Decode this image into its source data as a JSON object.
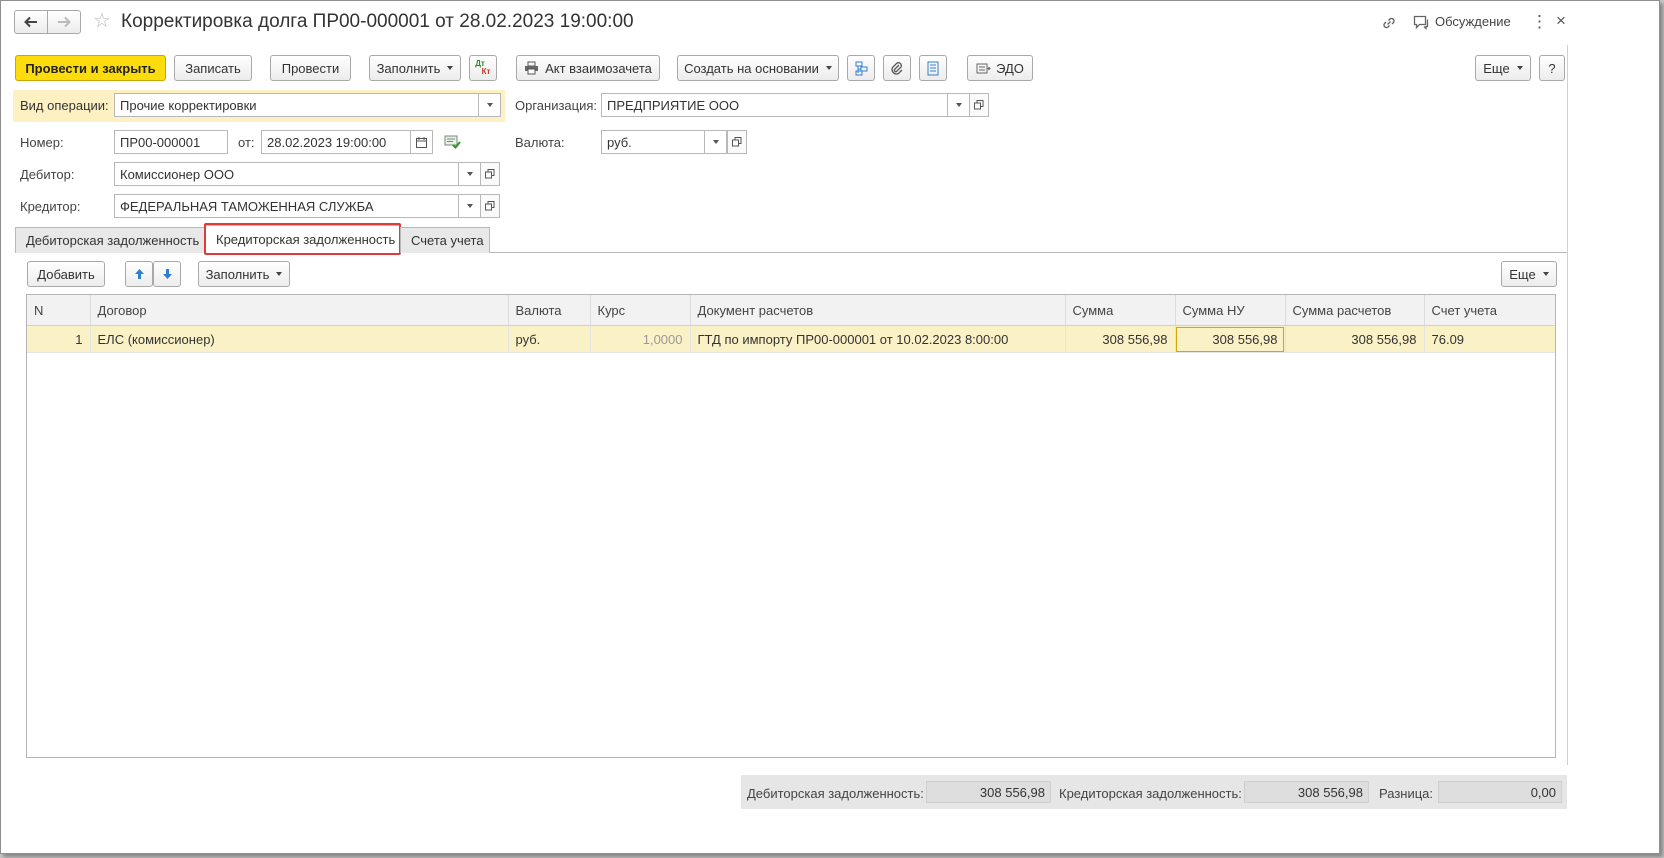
{
  "window": {
    "title": "Корректировка долга ПР00-000001 от 28.02.2023 19:00:00",
    "discussion_label": "Обсуждение"
  },
  "toolbar": {
    "post_close": "Провести и закрыть",
    "save": "Записать",
    "post": "Провести",
    "fill": "Заполнить",
    "dt_kt_top": "Дт",
    "dt_kt_bottom": "Кт",
    "offset_act": "Акт взаимозачета",
    "create_based": "Создать на основании",
    "edo": "ЭДО",
    "more": "Еще",
    "help": "?"
  },
  "form": {
    "operation_label": "Вид операции:",
    "operation_value": "Прочие корректировки",
    "org_label": "Организация:",
    "org_value": "ПРЕДПРИЯТИЕ ООО",
    "number_label": "Номер:",
    "number_value": "ПР00-000001",
    "date_label": "от:",
    "date_value": "28.02.2023 19:00:00",
    "currency_label": "Валюта:",
    "currency_value": "руб.",
    "debtor_label": "Дебитор:",
    "debtor_value": "Комиссионер ООО",
    "creditor_label": "Кредитор:",
    "creditor_value": "ФЕДЕРАЛЬНАЯ ТАМОЖЕННАЯ СЛУЖБА"
  },
  "tabs": [
    {
      "label": "Дебиторская задолженность"
    },
    {
      "label": "Кредиторская задолженность"
    },
    {
      "label": "Счета учета"
    }
  ],
  "table_toolbar": {
    "add": "Добавить",
    "fill": "Заполнить",
    "more": "Еще"
  },
  "table": {
    "headers": [
      "N",
      "Договор",
      "Валюта",
      "Курс",
      "Документ расчетов",
      "Сумма",
      "Сумма НУ",
      "Сумма расчетов",
      "Счет учета"
    ],
    "rows": [
      {
        "n": "1",
        "contract": "ЕЛС (комиссионер)",
        "currency": "руб.",
        "rate": "1,0000",
        "doc": "ГТД по импорту ПР00-000001 от 10.02.2023 8:00:00",
        "sum": "308 556,98",
        "sum_nu": "308 556,98",
        "sum_settle": "308 556,98",
        "account": "76.09"
      }
    ]
  },
  "footer": {
    "debit_label": "Дебиторская задолженность:",
    "debit_value": "308 556,98",
    "credit_label": "Кредиторская задолженность:",
    "credit_value": "308 556,98",
    "diff_label": "Разница:",
    "diff_value": "0,00"
  },
  "colors": {
    "primary_button": "#fddc0e",
    "highlight_row": "#fbf1c7",
    "operation_band": "#fdf0c2",
    "tab_highlight_border": "#e03a3a",
    "arrow_blue": "#2f7fd0"
  }
}
